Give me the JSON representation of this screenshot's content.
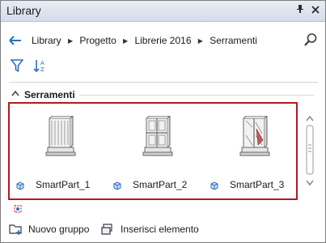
{
  "window": {
    "title": "Library",
    "pin_icon": "pin-icon",
    "close_icon": "close-icon"
  },
  "breadcrumb": {
    "items": [
      "Library",
      "Progetto",
      "Librerie 2016",
      "Serramenti"
    ]
  },
  "group": {
    "title": "Serramenti"
  },
  "items": [
    {
      "label": "SmartPart_1",
      "icon": "window-icon"
    },
    {
      "label": "SmartPart_2",
      "icon": "window-icon"
    },
    {
      "label": "SmartPart_3",
      "icon": "window-icon"
    }
  ],
  "actions": {
    "new_group": "Nuovo gruppo",
    "insert_element": "Inserisci elemento"
  },
  "colors": {
    "selection_border": "#b11a1f",
    "titlebar": "#dde3ee",
    "accent_blue": "#2f6fbf"
  }
}
